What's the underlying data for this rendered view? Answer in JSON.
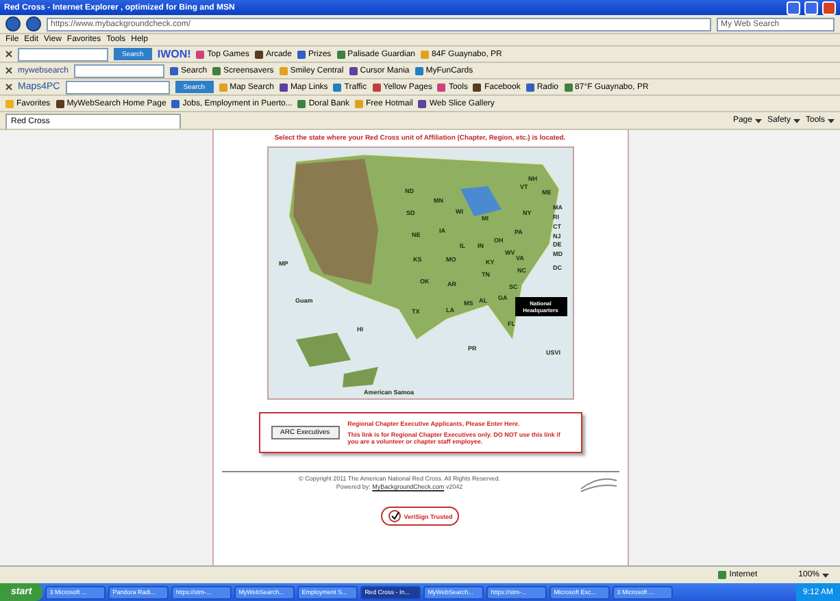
{
  "window": {
    "title": "Red Cross - Internet Explorer , optimized for Bing and MSN"
  },
  "address": {
    "value": "https://www.mybackgroundcheck.com/",
    "search_placeholder": "My Web Search"
  },
  "menu": [
    "File",
    "Edit",
    "View",
    "Favorites",
    "Tools",
    "Help"
  ],
  "toolbars": [
    {
      "kind": "iwon",
      "search_button": "Search",
      "brand": "IWON!",
      "items": [
        "Top Games",
        "Arcade",
        "Prizes",
        "Palisade Guardian",
        "84F Guaynabo, PR"
      ]
    },
    {
      "kind": "mywebsearch",
      "brand": "mywebsearch",
      "items": [
        "Search",
        "Screensavers",
        "Smiley Central",
        "Cursor Mania",
        "MyFunCards"
      ]
    },
    {
      "kind": "maps",
      "search_button": "Search",
      "brand": "Maps4PC",
      "items": [
        "Map Search",
        "Map Links",
        "Traffic",
        "Yellow Pages",
        "Tools",
        "Facebook",
        "Radio",
        "87°F Guaynabo, PR"
      ]
    }
  ],
  "favorites": {
    "label": "Favorites",
    "items": [
      "MyWebSearch Home Page",
      "Jobs, Employment in Puerto...",
      "Doral Bank",
      "Free Hotmail",
      "Web Slice Gallery"
    ]
  },
  "tabs": [
    {
      "label": "Red Cross",
      "selected": true
    }
  ],
  "command_bar": [
    "Page",
    "Safety",
    "Tools"
  ],
  "page": {
    "heading": "Select the state where your Red Cross unit of Affiliation (Chapter, Region, etc.) is located.",
    "map_labels": [
      "ND",
      "SD",
      "NE",
      "KS",
      "OK",
      "TX",
      "MN",
      "IA",
      "MO",
      "AR",
      "LA",
      "WI",
      "IL",
      "MS",
      "AL",
      "GA",
      "FL",
      "MI",
      "IN",
      "OH",
      "KY",
      "TN",
      "NC",
      "SC",
      "VA",
      "WV",
      "PA",
      "NY",
      "VT",
      "NH",
      "ME",
      "MA",
      "RI",
      "CT",
      "NJ",
      "DE",
      "MD",
      "DC",
      "MP",
      "Guam",
      "HI",
      "PR",
      "USVI",
      "American Samoa"
    ],
    "hq_label": "National Headquarters",
    "exec_button": "ARC Executives",
    "exec_title": "Regional Chapter Executive Applicants, Please Enter Here.",
    "exec_note": "This link is for Regional Chapter Executives only. DO NOT use this link if you are a volunteer or chapter staff employee.",
    "copyright": "© Copyright 2011 The American National Red Cross. All Rights Reserved.",
    "powered_by": "Powered by:",
    "powered_link": "MyBackgroundCheck.com",
    "version": "v2042",
    "seal_text": "VeriSign Trusted"
  },
  "status_bar": {
    "zone": "Internet",
    "zoom": "100%"
  },
  "taskbar": {
    "start": "start",
    "items": [
      {
        "label": "3 Microsoft ...",
        "selected": false
      },
      {
        "label": "Pandora Radi...",
        "selected": false
      },
      {
        "label": "https://stm-...",
        "selected": false
      },
      {
        "label": "MyWebSearch...",
        "selected": false
      },
      {
        "label": "Employment S...",
        "selected": false
      },
      {
        "label": "Red Cross - In...",
        "selected": true
      },
      {
        "label": "MyWebSearch...",
        "selected": false
      },
      {
        "label": "https://stm-...",
        "selected": false
      },
      {
        "label": "Microsoft Exc...",
        "selected": false
      },
      {
        "label": "3 Microsoft ...",
        "selected": false
      }
    ],
    "clock": "9:12 AM"
  }
}
